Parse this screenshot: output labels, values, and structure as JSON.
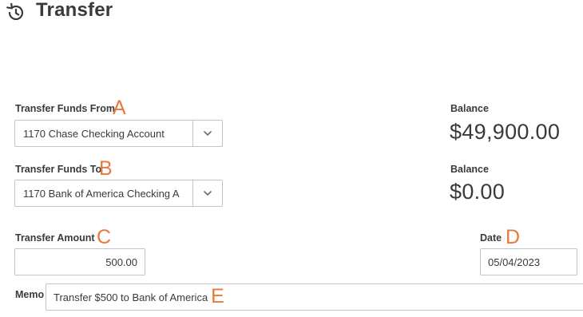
{
  "header": {
    "title": "Transfer",
    "icon": "history-icon"
  },
  "transfer_from": {
    "label": "Transfer Funds From",
    "marker": "A",
    "value": "1170 Chase Checking Account",
    "balance_label": "Balance",
    "balance": "$49,900.00"
  },
  "transfer_to": {
    "label": "Transfer Funds To",
    "marker": "B",
    "value": "1170 Bank of America Checking A",
    "balance_label": "Balance",
    "balance": "$0.00"
  },
  "amount": {
    "label": "Transfer Amount",
    "marker": "C",
    "value": "500.00"
  },
  "date": {
    "label": "Date",
    "marker": "D",
    "value": "05/04/2023"
  },
  "memo": {
    "label": "Memo",
    "marker": "E",
    "value": "Transfer $500 to Bank of America"
  },
  "colors": {
    "marker": "#e8793a",
    "text": "#393a3d",
    "border": "#c1c4c8"
  }
}
